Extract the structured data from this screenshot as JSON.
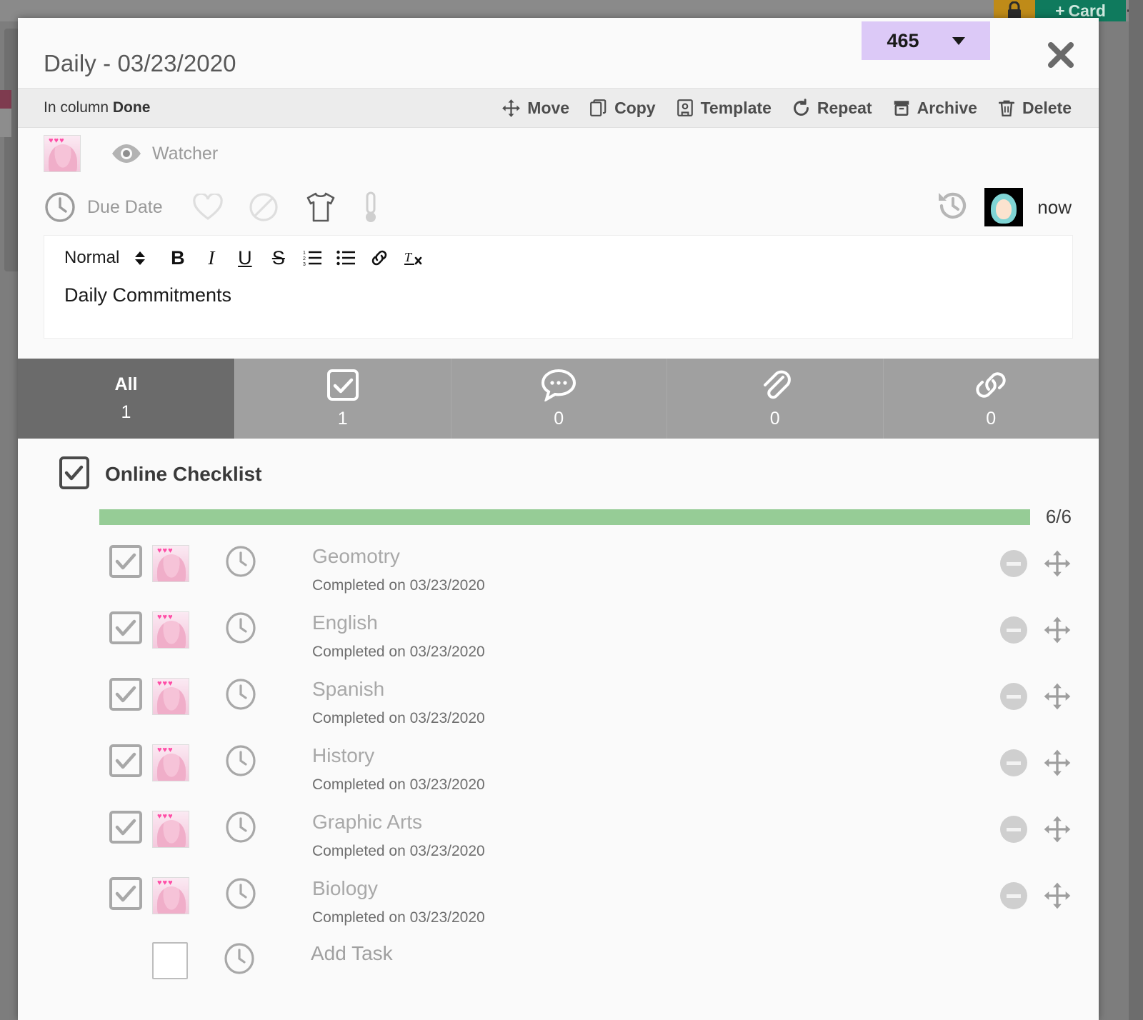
{
  "background": {
    "lock_icon": "lock-icon",
    "add_card_label": "Card",
    "gear_icon": "gear-icon"
  },
  "card": {
    "title": "Daily - 03/23/2020",
    "badge": {
      "value": "465",
      "caret_icon": "chevron-down-icon"
    },
    "close_icon": "close-icon",
    "column_prefix": "In column",
    "column_name": "Done",
    "actions": [
      {
        "label": "Move",
        "icon": "move-icon"
      },
      {
        "label": "Copy",
        "icon": "copy-icon"
      },
      {
        "label": "Template",
        "icon": "template-icon"
      },
      {
        "label": "Repeat",
        "icon": "repeat-icon"
      },
      {
        "label": "Archive",
        "icon": "archive-icon"
      },
      {
        "label": "Delete",
        "icon": "trash-icon"
      }
    ],
    "watcher": {
      "label": "Watcher",
      "icon": "eye-icon",
      "avatar": "member-avatar-pink"
    },
    "due_date": {
      "label": "Due Date",
      "icon": "clock-icon"
    },
    "attribute_icons": [
      {
        "name": "heart-icon"
      },
      {
        "name": "block-icon"
      },
      {
        "name": "tshirt-icon"
      },
      {
        "name": "thermometer-icon"
      }
    ],
    "history": {
      "icon": "history-icon",
      "avatar": "member-avatar-teal",
      "time": "now"
    }
  },
  "editor": {
    "style_label": "Normal",
    "stepper_icon": "updown-caret-icon",
    "buttons": [
      {
        "name": "bold-icon",
        "glyph": "B"
      },
      {
        "name": "italic-icon",
        "glyph": "I"
      },
      {
        "name": "underline-icon",
        "glyph": "U"
      },
      {
        "name": "strikethrough-icon",
        "glyph": "S"
      },
      {
        "name": "ordered-list-icon",
        "glyph": ""
      },
      {
        "name": "bullet-list-icon",
        "glyph": ""
      },
      {
        "name": "link-icon",
        "glyph": ""
      },
      {
        "name": "clear-format-icon",
        "glyph": ""
      }
    ],
    "content": "Daily Commitments"
  },
  "tabs": [
    {
      "label": "All",
      "count": "1",
      "icon": null,
      "active": true
    },
    {
      "label": "",
      "count": "1",
      "icon": "checkbox-icon",
      "active": false
    },
    {
      "label": "",
      "count": "0",
      "icon": "comment-icon",
      "active": false
    },
    {
      "label": "",
      "count": "0",
      "icon": "attachment-icon",
      "active": false
    },
    {
      "label": "",
      "count": "0",
      "icon": "link-chain-icon",
      "active": false
    }
  ],
  "checklist": {
    "icon": "checklist-icon",
    "title": "Online Checklist",
    "progress_fraction": "6/6",
    "progress_percent": 100,
    "progress_color": "#96cc96",
    "tasks": [
      {
        "name": "Geomotry",
        "subtitle": "Completed on 03/23/2020",
        "checked": true
      },
      {
        "name": "English",
        "subtitle": "Completed on 03/23/2020",
        "checked": true
      },
      {
        "name": "Spanish",
        "subtitle": "Completed on 03/23/2020",
        "checked": true
      },
      {
        "name": "History",
        "subtitle": "Completed on 03/23/2020",
        "checked": true
      },
      {
        "name": "Graphic Arts",
        "subtitle": "Completed on 03/23/2020",
        "checked": true
      },
      {
        "name": "Biology",
        "subtitle": "Completed on 03/23/2020",
        "checked": true
      }
    ],
    "add_task_label": "Add Task"
  }
}
